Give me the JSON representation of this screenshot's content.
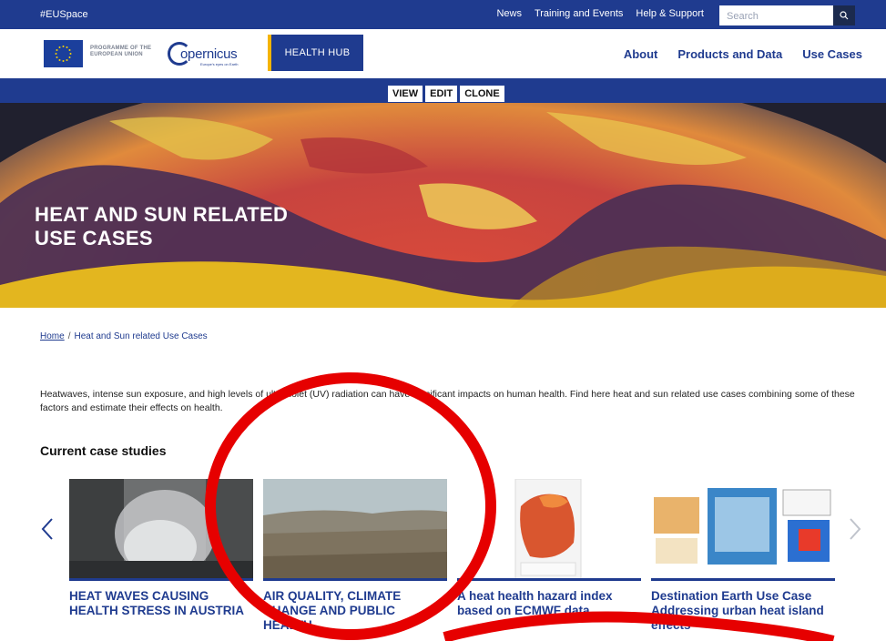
{
  "topbar": {
    "tag": "#EUSpace",
    "links": [
      "News",
      "Training and Events",
      "Help & Support"
    ],
    "search_placeholder": "Search"
  },
  "header": {
    "eu_line1": "PROGRAMME OF THE",
    "eu_line2": "EUROPEAN UNION",
    "copernicus_word": "opernicus",
    "copernicus_tagline": "Europe's eyes on Earth",
    "hub_label": "HEALTH HUB",
    "nav": [
      "About",
      "Products and Data",
      "Use Cases"
    ]
  },
  "editbar": {
    "tabs": [
      "VIEW",
      "EDIT",
      "CLONE"
    ]
  },
  "hero": {
    "title_line1": "HEAT AND SUN RELATED",
    "title_line2": "USE CASES"
  },
  "breadcrumb": {
    "home": "Home",
    "separator": "/",
    "current": "Heat and Sun related Use Cases"
  },
  "intro": {
    "text": "Heatwaves, intense sun exposure, and high levels of ultraviolet (UV) radiation can have significant impacts on human health. Find here heat and sun related use cases combining some of these factors and estimate their effects on health."
  },
  "section": {
    "title": "Current case studies"
  },
  "cards": [
    {
      "title": "HEAT WAVES CAUSING HEALTH STRESS IN AUSTRIA"
    },
    {
      "title": "AIR QUALITY, CLIMATE CHANGE AND PUBLIC HEALTH"
    },
    {
      "title": "A heat health hazard index based on ECMWF data"
    },
    {
      "title": "Destination Earth Use Case Addressing urban heat island effects"
    }
  ],
  "colors": {
    "brand_blue": "#1f3b8f",
    "accent_yellow": "#f5b400",
    "annotation_red": "#e60000"
  },
  "icons": {
    "search": "search-icon",
    "prev": "chevron-left-icon",
    "next": "chevron-right-icon"
  }
}
